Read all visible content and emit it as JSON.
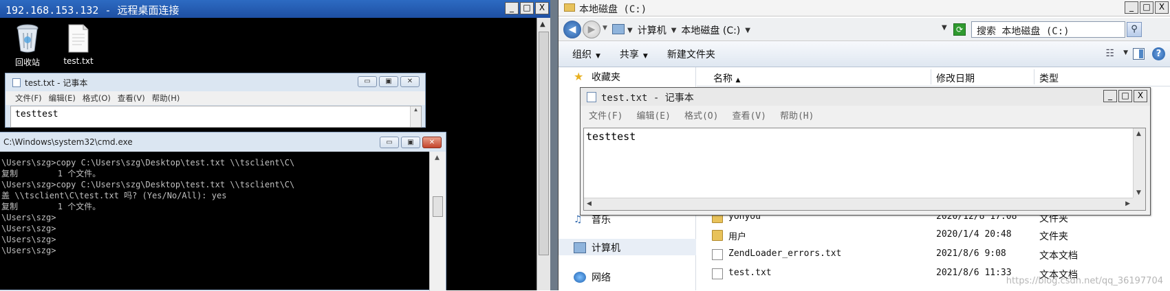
{
  "rdp": {
    "title": "192.168.153.132 - 远程桌面连接",
    "controls": {
      "minimize": "_",
      "maximize": "□",
      "close": "X"
    },
    "desktop_icons": [
      {
        "label": "回收站",
        "icon": "recycle-bin-icon"
      },
      {
        "label": "test.txt",
        "icon": "text-file-icon"
      }
    ],
    "notepad": {
      "title": "test.txt - 记事本",
      "menu": [
        "文件(F)",
        "编辑(E)",
        "格式(O)",
        "查看(V)",
        "帮助(H)"
      ],
      "content": "testtest"
    },
    "cmd": {
      "title": "C:\\Windows\\system32\\cmd.exe",
      "lines": [
        "",
        "\\Users\\szg>copy C:\\Users\\szg\\Desktop\\test.txt \\\\tsclient\\C\\",
        "复制        1 个文件。",
        "",
        "\\Users\\szg>copy C:\\Users\\szg\\Desktop\\test.txt \\\\tsclient\\C\\",
        "盖 \\\\tsclient\\C\\test.txt 吗? (Yes/No/All): yes",
        "复制        1 个文件。",
        "",
        "\\Users\\szg>",
        "\\Users\\szg>",
        "\\Users\\szg>",
        "\\Users\\szg>"
      ]
    }
  },
  "explorer": {
    "title": "本地磁盘 (C:)",
    "breadcrumb": [
      "计算机",
      "本地磁盘 (C:)"
    ],
    "search_placeholder": "搜索 本地磁盘 (C:)",
    "toolbar": {
      "organize": "组织",
      "share": "共享",
      "new_folder": "新建文件夹"
    },
    "nav": {
      "favorites": "收藏夹",
      "music": "音乐",
      "computer": "计算机",
      "network": "网络"
    },
    "columns": {
      "name": "名称",
      "date": "修改日期",
      "type": "类型"
    },
    "files": [
      {
        "name": "yonyou",
        "date": "2020/12/8 17:08",
        "type": "文件夹",
        "icon": "folder-icon"
      },
      {
        "name": "用户",
        "date": "2020/1/4 20:48",
        "type": "文件夹",
        "icon": "folder-icon"
      },
      {
        "name": "ZendLoader_errors.txt",
        "date": "2021/8/6 9:08",
        "type": "文本文档",
        "icon": "text-file-icon"
      },
      {
        "name": "test.txt",
        "date": "2021/8/6 11:33",
        "type": "文本文档",
        "icon": "text-file-icon"
      }
    ]
  },
  "notepad": {
    "title": "test.txt - 记事本",
    "menu": [
      "文件(F)",
      "编辑(E)",
      "格式(O)",
      "查看(V)",
      "帮助(H)"
    ],
    "content": "testtest"
  },
  "watermark": "https://blog.csdn.net/qq_36197704"
}
